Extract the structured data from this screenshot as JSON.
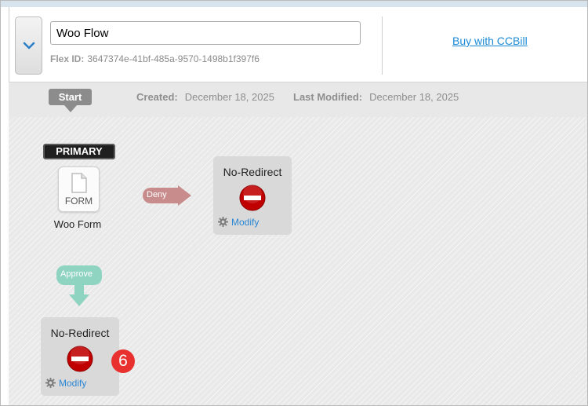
{
  "header": {
    "flow_name": "Woo Flow",
    "flex_id_label": "Flex ID:",
    "flex_id_value": "3647374e-41bf-485a-9570-1498b1f397f6",
    "buy_link": "Buy with CCBill"
  },
  "info": {
    "start_label": "Start",
    "created_label": "Created:",
    "created_value": "December 18, 2025",
    "modified_label": "Last Modified:",
    "modified_value": "December 18, 2025"
  },
  "flow": {
    "primary_badge": "PRIMARY",
    "form_tile_label": "FORM",
    "form_name": "Woo Form",
    "deny_label": "Deny",
    "approve_label": "Approve",
    "deny_node": {
      "title": "No-Redirect",
      "modify_label": "Modify"
    },
    "approve_node": {
      "title": "No-Redirect",
      "modify_label": "Modify"
    },
    "step_marker": "6"
  },
  "colors": {
    "deny_arrow": "#c98c8c",
    "approve_arrow": "#8fd3c1",
    "stop_icon": "#c00000",
    "link": "#2a86d3",
    "marker": "#e8302f"
  },
  "icons": [
    "chevron-down-icon",
    "document-icon",
    "stop-icon",
    "gear-icon"
  ]
}
